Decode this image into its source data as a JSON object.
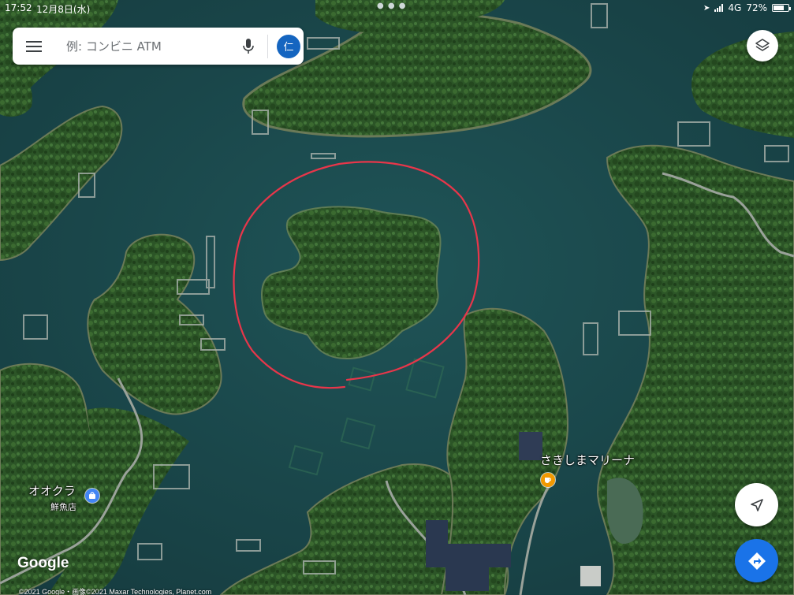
{
  "status_bar": {
    "time": "17:52",
    "date": "12月8日(水)",
    "network": "4G",
    "battery": "72%",
    "battery_level": 0.72
  },
  "search": {
    "placeholder": "例: コンビニ ATM",
    "account_initial": "仁"
  },
  "places": {
    "shop": {
      "name": "オオクラ",
      "category": "鮮魚店"
    },
    "marina": {
      "name": "さきしまマリーナ"
    }
  },
  "map": {
    "type": "satellite",
    "annotation": "red hand-drawn circle around heart-shaped island",
    "annotation_color": "#e8364a"
  },
  "branding": {
    "logo": "Google",
    "attribution": "©2021 Google・画像©2021 Maxar Technologies, Planet.com"
  },
  "colors": {
    "water": "#1c4a4e",
    "forest": "#2f5a2a",
    "accent_blue": "#1a73e8",
    "cafe_orange": "#f29900"
  }
}
